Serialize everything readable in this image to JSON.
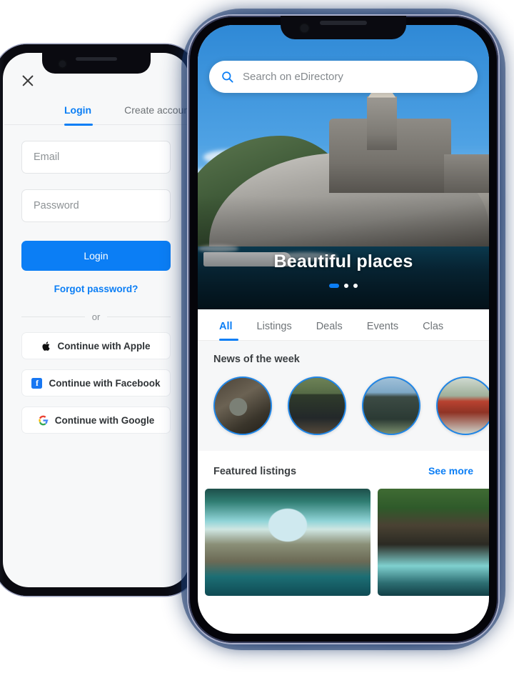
{
  "left_phone": {
    "name": "login-screen",
    "close_icon": "close-icon",
    "tabs": [
      {
        "label": "Login",
        "active": true
      },
      {
        "label": "Create account",
        "active": false
      }
    ],
    "fields": [
      {
        "name": "email",
        "placeholder": "Email",
        "value": ""
      },
      {
        "name": "password",
        "placeholder": "Password",
        "value": ""
      }
    ],
    "primary_button": "Login",
    "forgot_link": "Forgot password?",
    "divider_label": "or",
    "social_buttons": [
      {
        "icon": "apple-icon",
        "label": "Continue with Apple"
      },
      {
        "icon": "facebook-icon",
        "label": "Continue with Facebook"
      },
      {
        "icon": "google-icon",
        "label": "Continue with Google"
      }
    ]
  },
  "right_phone": {
    "name": "edirectory-home",
    "search": {
      "icon": "search-icon",
      "placeholder": "Search on eDirectory",
      "value": ""
    },
    "hero": {
      "title": "Beautiful places",
      "image_alt": "coastal church on rocky cliff",
      "carousel": {
        "total": 3,
        "active_index": 0
      }
    },
    "tabs": [
      {
        "label": "All",
        "active": true
      },
      {
        "label": "Listings",
        "active": false
      },
      {
        "label": "Deals",
        "active": false
      },
      {
        "label": "Events",
        "active": false
      },
      {
        "label": "Clas",
        "active": false
      }
    ],
    "news": {
      "title": "News of the week",
      "items": [
        {
          "alt": "camping gear on rocks"
        },
        {
          "alt": "black and tan backpack"
        },
        {
          "alt": "hand holding backpack"
        },
        {
          "alt": "car on forest road"
        }
      ]
    },
    "featured": {
      "title": "Featured listings",
      "see_more": "See more",
      "cards": [
        {
          "alt": "natural rock arch over turquoise lagoon"
        },
        {
          "alt": "waterfall in green jungle"
        }
      ]
    }
  },
  "colors": {
    "accent": "#0b7ef5",
    "ring": "#1f86e8",
    "text": "#3b3f42",
    "muted": "#6f7478",
    "glow": "#17366c"
  }
}
